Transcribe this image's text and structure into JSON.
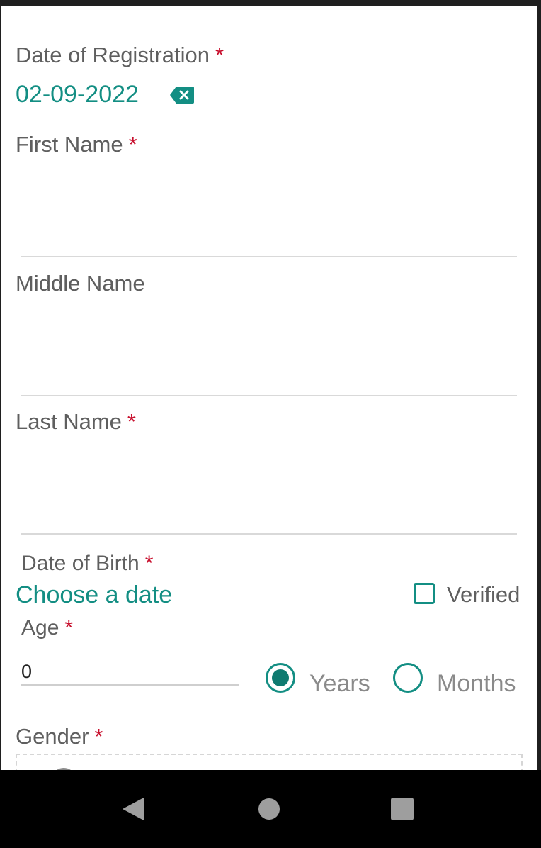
{
  "form": {
    "registration_date": {
      "label": "Date of Registration",
      "required_mark": "*",
      "value": "02-09-2022",
      "clear_icon": "backspace-clear-icon"
    },
    "first_name": {
      "label": "First Name",
      "required_mark": "*",
      "value": ""
    },
    "middle_name": {
      "label": "Middle Name",
      "value": ""
    },
    "last_name": {
      "label": "Last Name",
      "required_mark": "*",
      "value": ""
    },
    "date_of_birth": {
      "label": "Date of Birth",
      "required_mark": "*",
      "picker_text": "Choose a date",
      "verified_label": "Verified",
      "verified_checked": false
    },
    "age": {
      "label": "Age",
      "required_mark": "*",
      "value": "0",
      "unit_options": [
        {
          "label": "Years",
          "selected": true
        },
        {
          "label": "Months",
          "selected": false
        }
      ]
    },
    "gender": {
      "label": "Gender",
      "required_mark": "*"
    }
  },
  "navigation_bar": {
    "back_icon": "back-triangle-icon",
    "home_icon": "home-circle-icon",
    "recents_icon": "recents-square-icon"
  },
  "colors": {
    "accent": "#138e83",
    "required": "#c8102e",
    "label": "#5f5f5f",
    "background": "#ffffff",
    "navbar": "#000000"
  }
}
